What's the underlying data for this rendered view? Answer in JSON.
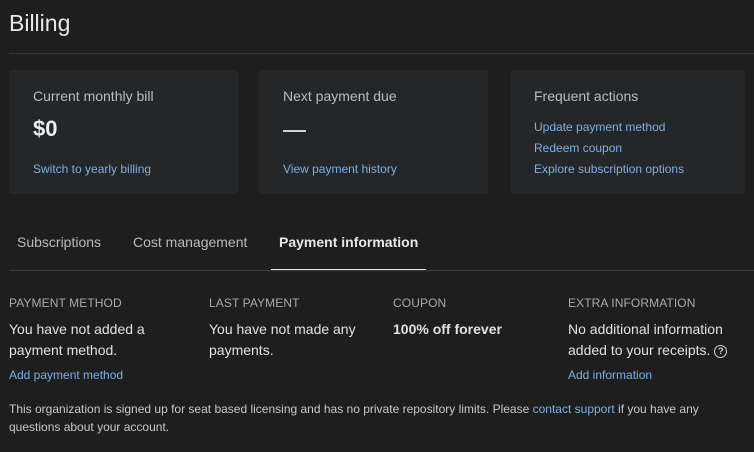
{
  "page": {
    "title": "Billing"
  },
  "cards": {
    "monthly": {
      "label": "Current monthly bill",
      "value": "$0",
      "link": "Switch to yearly billing"
    },
    "next": {
      "label": "Next payment due",
      "link": "View payment history"
    },
    "actions": {
      "label": "Frequent actions",
      "links": [
        "Update payment method",
        "Redeem coupon",
        "Explore subscription options"
      ]
    }
  },
  "tabs": [
    {
      "label": "Subscriptions",
      "active": false
    },
    {
      "label": "Cost management",
      "active": false
    },
    {
      "label": "Payment information",
      "active": true
    }
  ],
  "payment_info": {
    "method": {
      "heading": "PAYMENT METHOD",
      "text": "You have not added a payment method.",
      "link": "Add payment method"
    },
    "last": {
      "heading": "LAST PAYMENT",
      "text": "You have not made any payments."
    },
    "coupon": {
      "heading": "COUPON",
      "text": "100% off forever"
    },
    "extra": {
      "heading": "EXTRA INFORMATION",
      "text": "No additional information added to your receipts.",
      "link": "Add information"
    }
  },
  "footer": {
    "before": "This organization is signed up for seat based licensing and has no private repository limits. Please ",
    "link": "contact support",
    "after": " if you have any questions about your account."
  },
  "colors": {
    "background": "#1e1e1f",
    "card": "#252627",
    "link": "#7ab1e8"
  },
  "icons": {
    "help": "question-circle-icon"
  }
}
